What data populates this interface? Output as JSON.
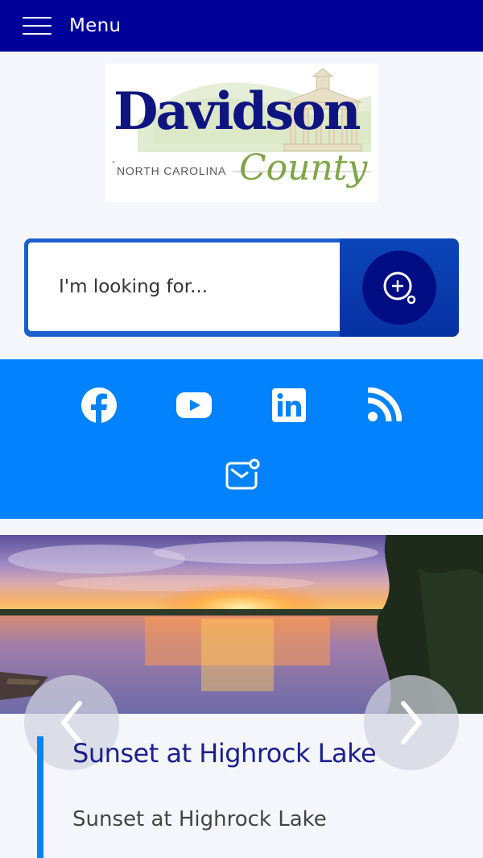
{
  "topbar": {
    "menu_label": "Menu"
  },
  "logo": {
    "main": "Davidson",
    "sub": "NORTH CAROLINA",
    "script": "County"
  },
  "search": {
    "placeholder": "I'm looking for..."
  },
  "social": {
    "icons": [
      "facebook-icon",
      "youtube-icon",
      "linkedin-icon",
      "rss-icon",
      "email-notify-icon"
    ]
  },
  "slider": {
    "title": "Sunset at Highrock Lake",
    "description": "Sunset at Highrock Lake"
  },
  "colors": {
    "topbar": "#010099",
    "social_bar": "#0382fd",
    "search_border": "#1a5fcc",
    "search_circle": "#010d83",
    "caption_title": "#1b1f8e",
    "caption_accent": "#0b82f0"
  }
}
